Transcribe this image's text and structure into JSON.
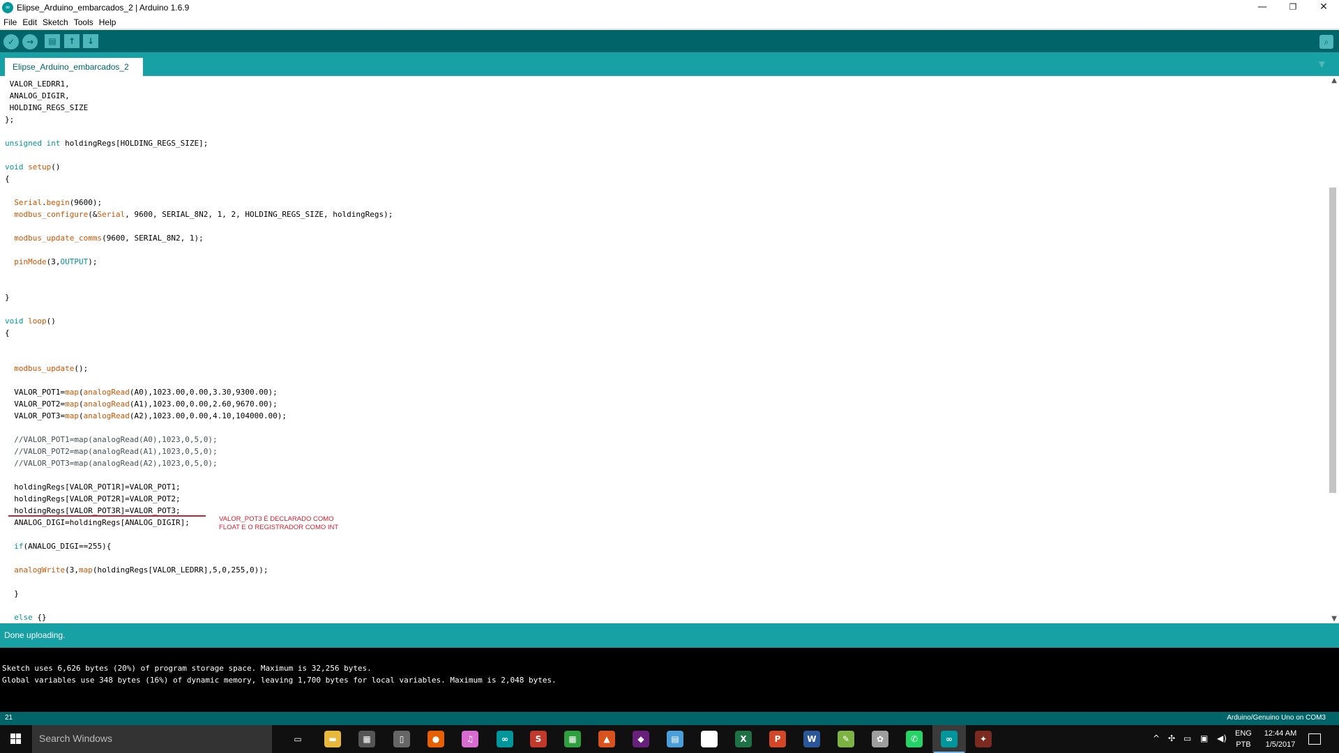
{
  "window": {
    "title": "Elipse_Arduino_embarcados_2 | Arduino 1.6.9",
    "app_icon": "arduino-infinity-icon",
    "controls": {
      "minimize": "—",
      "maximize": "❐",
      "close": "✕"
    }
  },
  "menu": [
    "File",
    "Edit",
    "Sketch",
    "Tools",
    "Help"
  ],
  "toolbar": {
    "verify_glyph": "✓",
    "upload_glyph": "→",
    "new_glyph": "▤",
    "open_glyph": "↑",
    "save_glyph": "↓",
    "serial_glyph": "⌕"
  },
  "tabs": {
    "active": "Elipse_Arduino_embarcados_2",
    "menu_glyph": "▼"
  },
  "code_lines": [
    [
      {
        "t": " VALOR_LEDRR1,"
      }
    ],
    [
      {
        "t": " ANALOG_DIGIR,"
      }
    ],
    [
      {
        "t": " HOLDING_REGS_SIZE"
      }
    ],
    [
      {
        "t": "};"
      }
    ],
    [
      {
        "t": ""
      }
    ],
    [
      {
        "t": "unsigned",
        "c": "kw"
      },
      {
        "t": " "
      },
      {
        "t": "int",
        "c": "kw"
      },
      {
        "t": " holdingRegs[HOLDING_REGS_SIZE];"
      }
    ],
    [
      {
        "t": ""
      }
    ],
    [
      {
        "t": "void",
        "c": "kw"
      },
      {
        "t": " "
      },
      {
        "t": "setup",
        "c": "fn"
      },
      {
        "t": "()"
      }
    ],
    [
      {
        "t": "{"
      }
    ],
    [
      {
        "t": ""
      }
    ],
    [
      {
        "t": "  "
      },
      {
        "t": "Serial",
        "c": "fn"
      },
      {
        "t": "."
      },
      {
        "t": "begin",
        "c": "fn"
      },
      {
        "t": "(9600);"
      }
    ],
    [
      {
        "t": "  "
      },
      {
        "t": "modbus_configure",
        "c": "fn"
      },
      {
        "t": "(&"
      },
      {
        "t": "Serial",
        "c": "fn"
      },
      {
        "t": ", 9600, SERIAL_8N2, 1, 2, HOLDING_REGS_SIZE, holdingRegs);"
      }
    ],
    [
      {
        "t": ""
      }
    ],
    [
      {
        "t": "  "
      },
      {
        "t": "modbus_update_comms",
        "c": "fn"
      },
      {
        "t": "(9600, SERIAL_8N2, 1);"
      }
    ],
    [
      {
        "t": ""
      }
    ],
    [
      {
        "t": "  "
      },
      {
        "t": "pinMode",
        "c": "fn"
      },
      {
        "t": "(3,"
      },
      {
        "t": "OUTPUT",
        "c": "kw"
      },
      {
        "t": ");"
      }
    ],
    [
      {
        "t": ""
      }
    ],
    [
      {
        "t": ""
      }
    ],
    [
      {
        "t": "}"
      }
    ],
    [
      {
        "t": ""
      }
    ],
    [
      {
        "t": "void",
        "c": "kw"
      },
      {
        "t": " "
      },
      {
        "t": "loop",
        "c": "fn"
      },
      {
        "t": "()"
      }
    ],
    [
      {
        "t": "{"
      }
    ],
    [
      {
        "t": ""
      }
    ],
    [
      {
        "t": ""
      }
    ],
    [
      {
        "t": "  "
      },
      {
        "t": "modbus_update",
        "c": "fn"
      },
      {
        "t": "();"
      }
    ],
    [
      {
        "t": ""
      }
    ],
    [
      {
        "t": "  VALOR_POT1="
      },
      {
        "t": "map",
        "c": "fn"
      },
      {
        "t": "("
      },
      {
        "t": "analogRead",
        "c": "fn"
      },
      {
        "t": "(A0),1023.00,0.00,3.30,9300.00);"
      }
    ],
    [
      {
        "t": "  VALOR_POT2="
      },
      {
        "t": "map",
        "c": "fn"
      },
      {
        "t": "("
      },
      {
        "t": "analogRead",
        "c": "fn"
      },
      {
        "t": "(A1),1023.00,0.00,2.60,9670.00);"
      }
    ],
    [
      {
        "t": "  VALOR_POT3="
      },
      {
        "t": "map",
        "c": "fn"
      },
      {
        "t": "("
      },
      {
        "t": "analogRead",
        "c": "fn"
      },
      {
        "t": "(A2),1023.00,0.00,4.10,104000.00);"
      }
    ],
    [
      {
        "t": ""
      }
    ],
    [
      {
        "t": "  //VALOR_POT1=map(analogRead(A0),1023,0,5,0);",
        "c": "cm"
      }
    ],
    [
      {
        "t": "  //VALOR_POT2=map(analogRead(A1),1023,0,5,0);",
        "c": "cm"
      }
    ],
    [
      {
        "t": "  //VALOR_POT3=map(analogRead(A2),1023,0,5,0);",
        "c": "cm"
      }
    ],
    [
      {
        "t": ""
      }
    ],
    [
      {
        "t": "  holdingRegs[VALOR_POT1R]=VALOR_POT1;"
      }
    ],
    [
      {
        "t": "  holdingRegs[VALOR_POT2R]=VALOR_POT2;"
      }
    ],
    [
      {
        "t": "  holdingRegs[VALOR_POT3R]=VALOR_POT3;"
      }
    ],
    [
      {
        "t": "  ANALOG_DIGI=holdingRegs[ANALOG_DIGIR];"
      }
    ],
    [
      {
        "t": ""
      }
    ],
    [
      {
        "t": "  "
      },
      {
        "t": "if",
        "c": "kw"
      },
      {
        "t": "(ANALOG_DIGI==255){"
      }
    ],
    [
      {
        "t": ""
      }
    ],
    [
      {
        "t": "  "
      },
      {
        "t": "analogWrite",
        "c": "fn"
      },
      {
        "t": "(3,"
      },
      {
        "t": "map",
        "c": "fn"
      },
      {
        "t": "(holdingRegs[VALOR_LEDRR],5,0,255,0));"
      }
    ],
    [
      {
        "t": ""
      }
    ],
    [
      {
        "t": "  }"
      }
    ],
    [
      {
        "t": ""
      }
    ],
    [
      {
        "t": "  "
      },
      {
        "t": "else",
        "c": "kw"
      },
      {
        "t": " {}"
      }
    ]
  ],
  "annotation": {
    "line1": "VALOR_POT3 É DECLARADO COMO",
    "line2": "FLOAT E O REGISTRADOR COMO INT"
  },
  "status": {
    "message": "Done uploading."
  },
  "console": {
    "line1": "Sketch uses 6,626 bytes (20%) of program storage space. Maximum is 32,256 bytes.",
    "line2": "Global variables use 348 bytes (16%) of dynamic memory, leaving 1,700 bytes for local variables. Maximum is 2,048 bytes."
  },
  "footer": {
    "line_number": "21",
    "board": "Arduino/Genuino Uno on COM3"
  },
  "taskbar": {
    "search_placeholder": "Search Windows",
    "apps": [
      {
        "name": "task-view-icon",
        "glyph": "▭",
        "color": "transparent"
      },
      {
        "name": "file-explorer-icon",
        "glyph": "▬",
        "color": "#e8b83a"
      },
      {
        "name": "calculator-icon",
        "glyph": "▦",
        "color": "#555555"
      },
      {
        "name": "phone-icon",
        "glyph": "▯",
        "color": "#666666"
      },
      {
        "name": "firefox-icon",
        "glyph": "●",
        "color": "#e66000"
      },
      {
        "name": "itunes-icon",
        "glyph": "♫",
        "color": "#d86bd0"
      },
      {
        "name": "arduino-icon",
        "glyph": "∞",
        "color": "#00979c"
      },
      {
        "name": "matlab-stateflow-icon",
        "glyph": "S",
        "color": "#c0392b"
      },
      {
        "name": "store-icon",
        "glyph": "▦",
        "color": "#2e9e3e"
      },
      {
        "name": "matlab-icon",
        "glyph": "▲",
        "color": "#d9531e"
      },
      {
        "name": "visual-studio-icon",
        "glyph": "◆",
        "color": "#68217a"
      },
      {
        "name": "notes-icon",
        "glyph": "▤",
        "color": "#4a9fd8"
      },
      {
        "name": "solitaire-icon",
        "glyph": "♠",
        "color": "#ffffff"
      },
      {
        "name": "excel-icon",
        "glyph": "X",
        "color": "#1e7145"
      },
      {
        "name": "powerpoint-icon",
        "glyph": "P",
        "color": "#d24726"
      },
      {
        "name": "word-icon",
        "glyph": "W",
        "color": "#2b579a"
      },
      {
        "name": "notepad-icon",
        "glyph": "✎",
        "color": "#7cb342"
      },
      {
        "name": "paint-icon",
        "glyph": "✿",
        "color": "#9e9e9e"
      },
      {
        "name": "whatsapp-icon",
        "glyph": "✆",
        "color": "#25d366"
      },
      {
        "name": "arduino-active-icon",
        "glyph": "∞",
        "color": "#00979c"
      },
      {
        "name": "elipse-icon",
        "glyph": "✦",
        "color": "#7a2a1e"
      }
    ],
    "tray": {
      "chevron": "^",
      "language": "ENG",
      "layout": "PTB",
      "time": "12:44 AM",
      "date": "1/5/2017"
    }
  }
}
